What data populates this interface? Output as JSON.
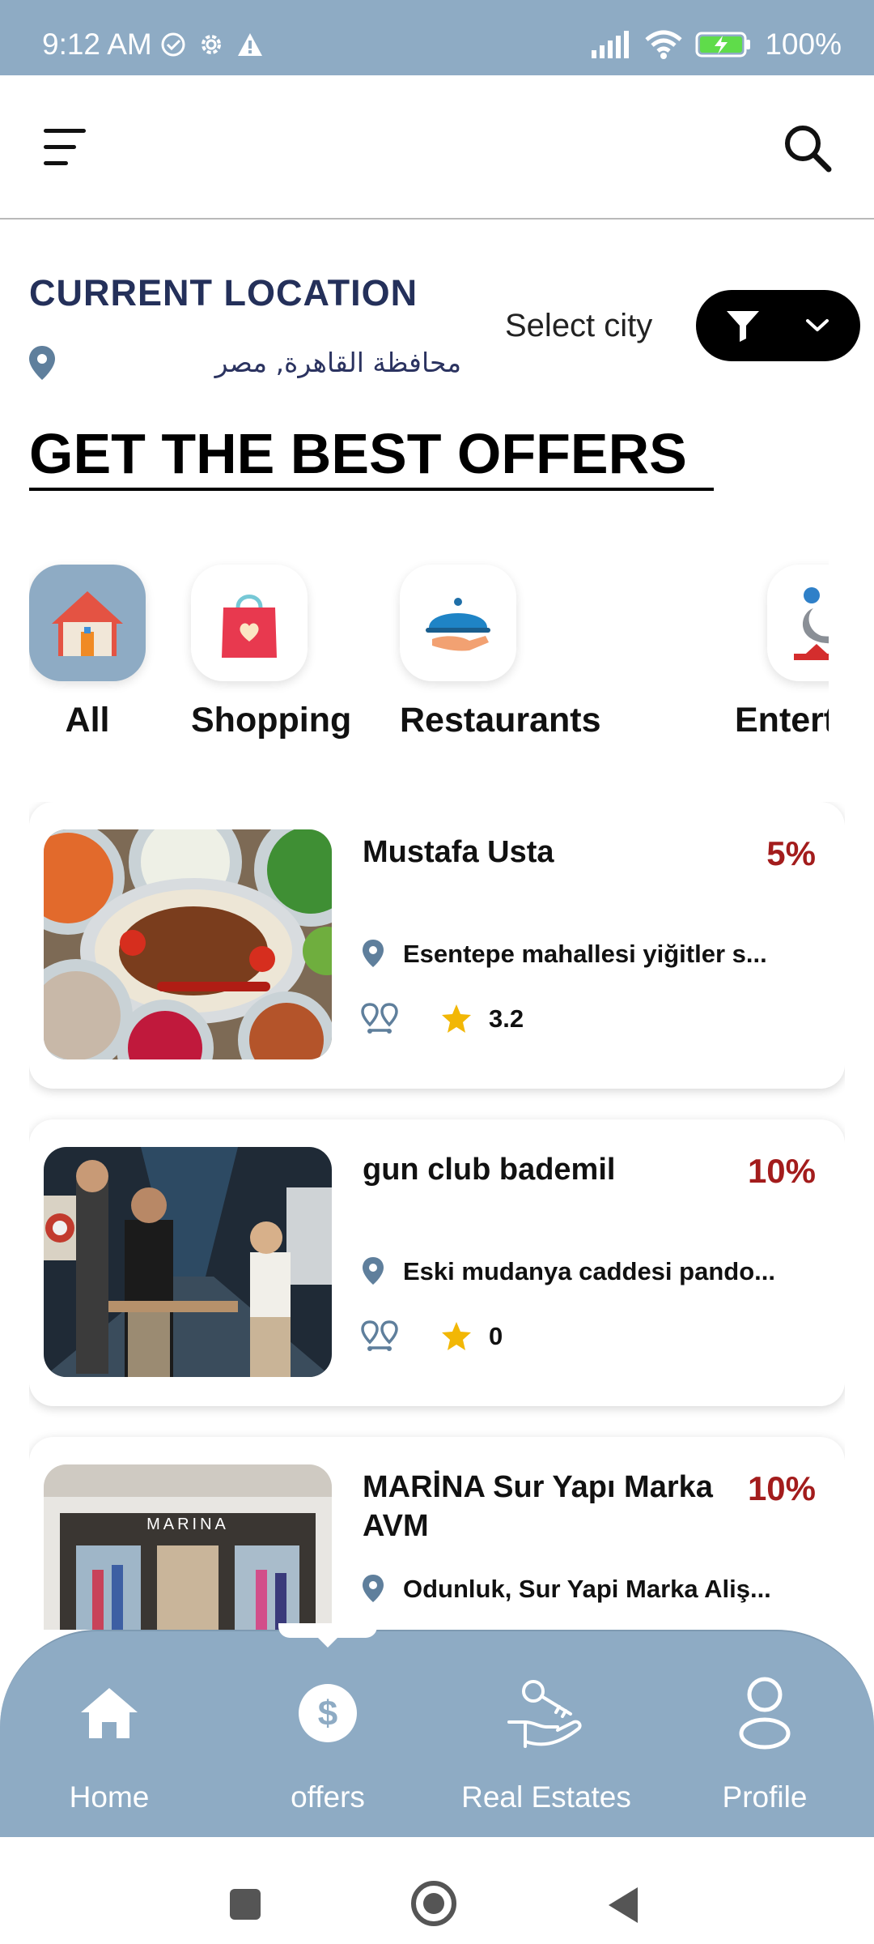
{
  "status_bar": {
    "time": "9:12 AM",
    "battery": "100%",
    "icons": [
      "check-circle-icon",
      "settings-icon",
      "warning-icon",
      "signal-icon",
      "wifi-icon",
      "battery-charging-icon"
    ]
  },
  "header": {
    "menu_icon": "menu-icon",
    "search_icon": "search-icon"
  },
  "location": {
    "label": "CURRENT LOCATION",
    "value": "محافظة القاهرة, مصر",
    "select_city": "Select city"
  },
  "offers_title": "GET THE BEST OFFERS",
  "categories": [
    {
      "label": "All",
      "icon": "house-icon",
      "active": true
    },
    {
      "label": "Shopping",
      "icon": "shopping-bag-icon",
      "active": false
    },
    {
      "label": "Restaurants",
      "icon": "food-cloche-icon",
      "active": false
    },
    {
      "label": "Entertain",
      "icon": "seal-circus-icon",
      "active": false
    }
  ],
  "offers": [
    {
      "name": "Mustafa Usta",
      "discount": "5%",
      "address": "Esentepe mahallesi yiğitler s...",
      "rating": "3.2"
    },
    {
      "name": "gun club bademil",
      "discount": "10%",
      "address": "Eski mudanya caddesi pando...",
      "rating": "0"
    },
    {
      "name": "MARİNA Sur Yapı Marka AVM",
      "discount": "10%",
      "address": "Odunluk, Sur Yapi Marka Aliş...",
      "rating": "",
      "storefront_sign": "MARINA"
    }
  ],
  "bottom_nav": [
    {
      "label": "Home",
      "icon": "home-icon"
    },
    {
      "label": "offers",
      "icon": "dollar-coin-icon"
    },
    {
      "label": "Real Estates",
      "icon": "hand-key-icon"
    },
    {
      "label": "Profile",
      "icon": "profile-icon"
    }
  ],
  "colors": {
    "accent": "#8eabc4",
    "discount": "#a31c1c",
    "location_label": "#24305a",
    "star": "#f2b705",
    "pin": "#5f7f9c"
  }
}
